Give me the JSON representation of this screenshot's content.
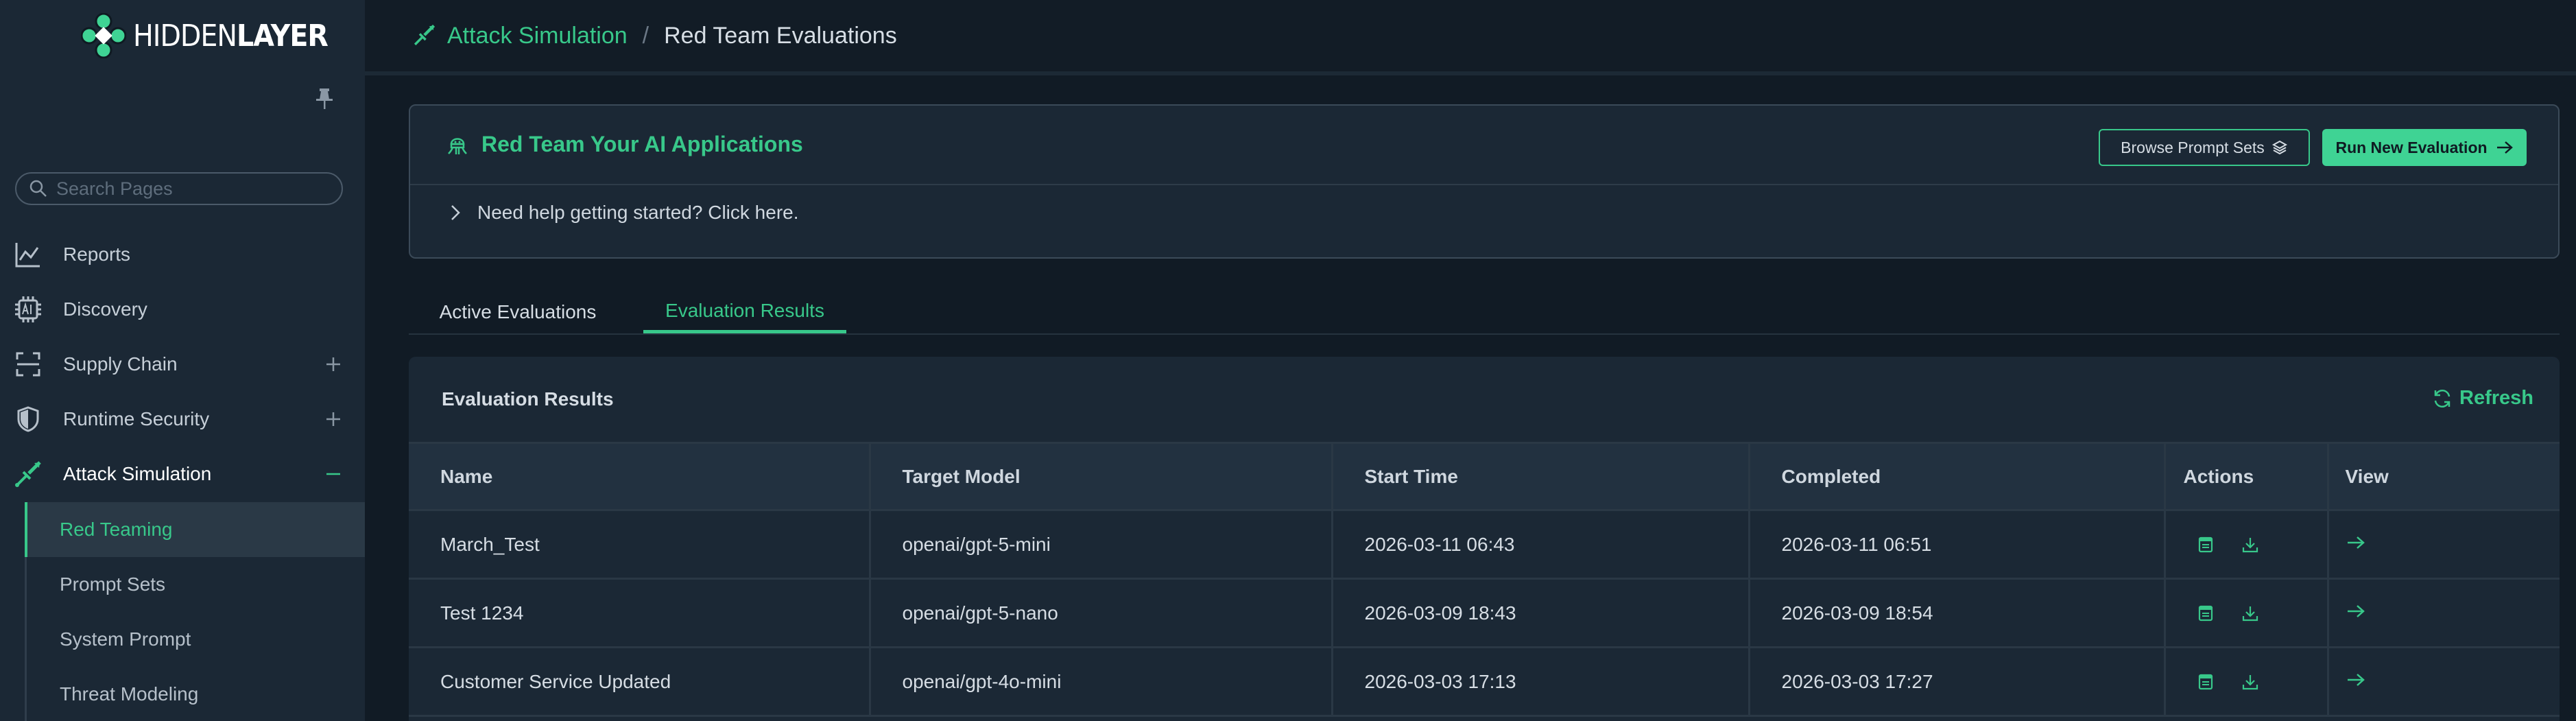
{
  "brand": {
    "logo_light": "HIDDEN",
    "logo_bold": "LAYER"
  },
  "sidebar": {
    "search_placeholder": "Search Pages",
    "items": [
      {
        "label": "Reports",
        "icon": "chart-line-icon"
      },
      {
        "label": "Discovery",
        "icon": "ai-chip-icon"
      },
      {
        "label": "Supply Chain",
        "icon": "scan-icon",
        "expand": "plus"
      },
      {
        "label": "Runtime Security",
        "icon": "shield-icon",
        "expand": "plus"
      },
      {
        "label": "Attack Simulation",
        "icon": "sword-icon",
        "expand": "minus"
      }
    ],
    "subitems": [
      {
        "label": "Red Teaming",
        "active": true
      },
      {
        "label": "Prompt Sets"
      },
      {
        "label": "System Prompt"
      },
      {
        "label": "Threat Modeling"
      }
    ]
  },
  "breadcrumb": {
    "parent": "Attack Simulation",
    "separator": "/",
    "current": "Red Team Evaluations"
  },
  "banner": {
    "title": "Red Team Your AI Applications",
    "browse_label": "Browse Prompt Sets",
    "run_label": "Run New Evaluation",
    "help_text": "Need help getting started? Click here."
  },
  "tabs": [
    {
      "label": "Active Evaluations"
    },
    {
      "label": "Evaluation Results",
      "active": true
    }
  ],
  "results": {
    "title": "Evaluation Results",
    "refresh_label": "Refresh",
    "columns": [
      "Name",
      "Target Model",
      "Start Time",
      "Completed",
      "Actions",
      "View"
    ],
    "rows": [
      {
        "name": "March_Test",
        "model": "openai/gpt-5-mini",
        "start": "2026-03-11 06:43",
        "completed": "2026-03-11 06:51"
      },
      {
        "name": "Test 1234",
        "model": "openai/gpt-5-nano",
        "start": "2026-03-09 18:43",
        "completed": "2026-03-09 18:54"
      },
      {
        "name": "Customer Service Updated",
        "model": "openai/gpt-4o-mini",
        "start": "2026-03-03 17:13",
        "completed": "2026-03-03 17:27"
      }
    ]
  },
  "colors": {
    "accent": "#38c88a",
    "sidebar_bg": "#1b2835",
    "page_bg": "#111b25",
    "card_bg": "#1b2835"
  }
}
